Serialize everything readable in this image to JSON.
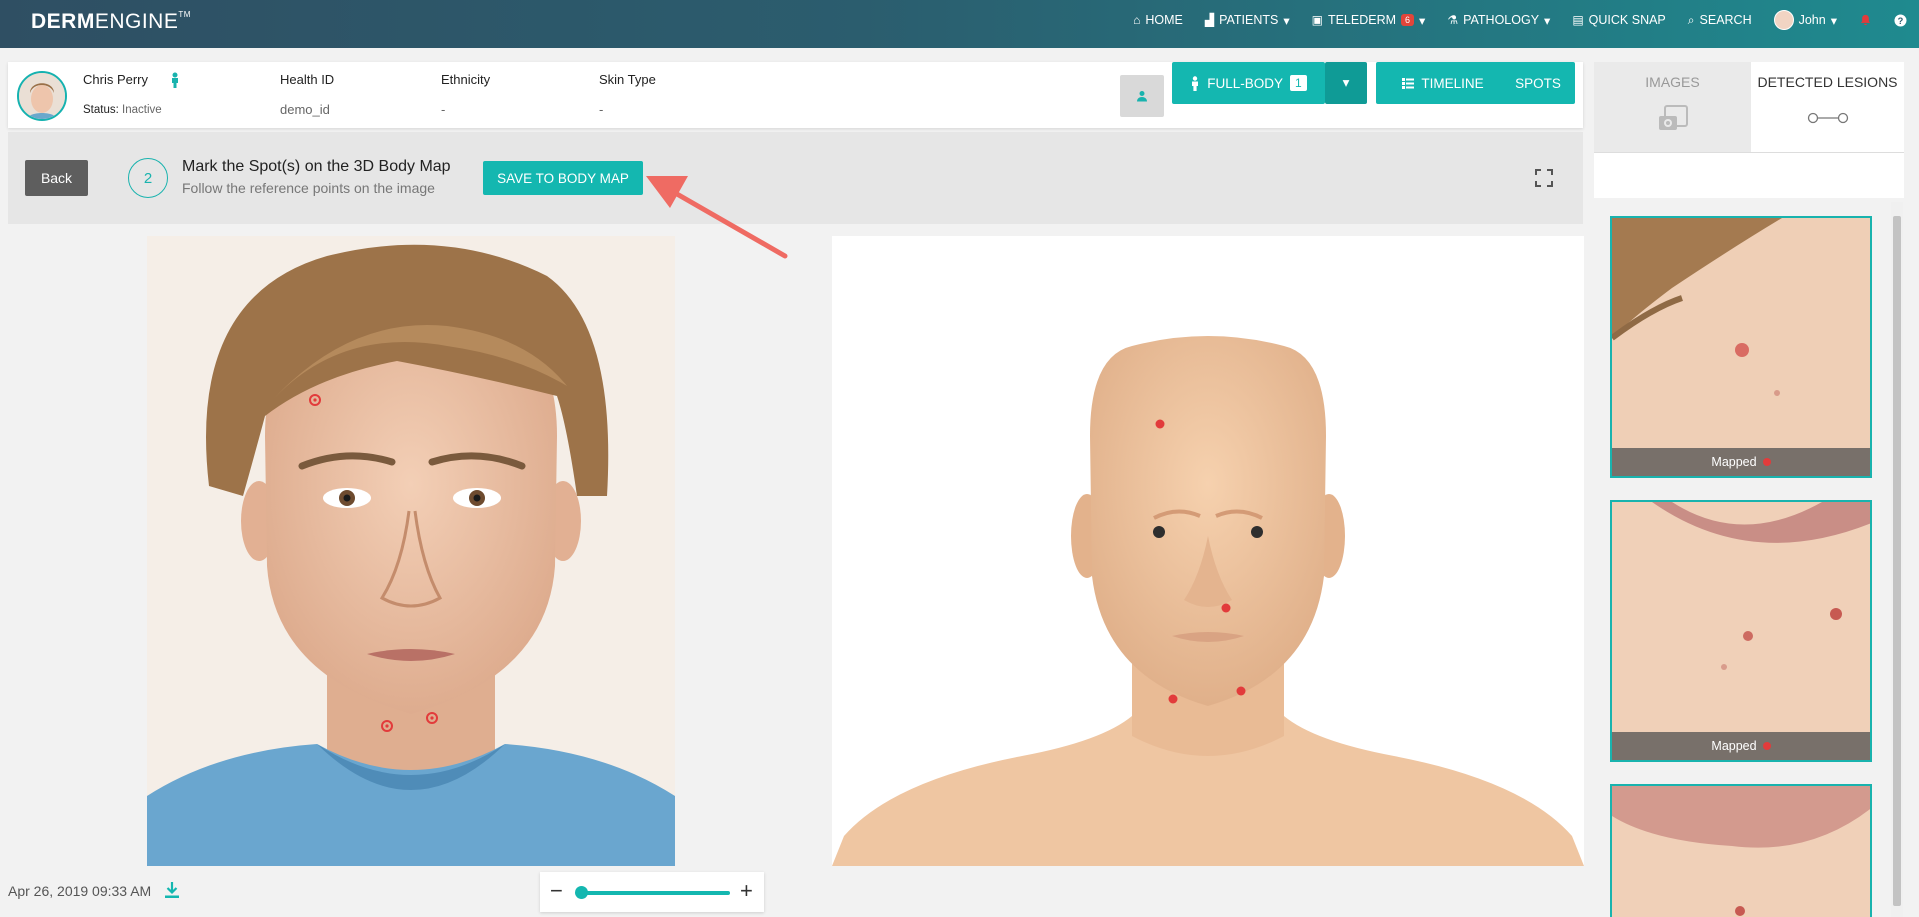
{
  "nav": {
    "logo_bold": "DERM",
    "logo_light": "ENGINE",
    "logo_tm": "TM",
    "items": [
      {
        "label": "HOME",
        "icon": "home-icon"
      },
      {
        "label": "PATIENTS",
        "icon": "patients-icon"
      },
      {
        "label": "TELEDERM",
        "icon": "telederm-icon",
        "badge": "6"
      },
      {
        "label": "PATHOLOGY",
        "icon": "microscope-icon"
      },
      {
        "label": "QUICK SNAP",
        "icon": "camera-icon"
      },
      {
        "label": "SEARCH",
        "icon": "search-icon"
      },
      {
        "label": "John",
        "icon": "avatar"
      }
    ]
  },
  "patient": {
    "name": "Chris Perry",
    "status_label": "Status:",
    "status_value": "Inactive",
    "health_id_label": "Health ID",
    "health_id_value": "demo_id",
    "ethnicity_label": "Ethnicity",
    "ethnicity_value": "-",
    "skin_type_label": "Skin Type",
    "skin_type_value": "-"
  },
  "actions": {
    "full_body_label": "FULL-BODY",
    "full_body_count": "1",
    "timeline_label": "TIMELINE",
    "spots_label": "SPOTS"
  },
  "right_panel": {
    "tab_images": "IMAGES",
    "tab_detected": "DETECTED LESIONS",
    "thumbs": [
      {
        "status": "Mapped"
      },
      {
        "status": "Mapped"
      }
    ]
  },
  "step": {
    "back_label": "Back",
    "number": "2",
    "title": "Mark the Spot(s) on the 3D Body Map",
    "subtitle": "Follow the reference points on the image",
    "save_label": "SAVE TO BODY MAP"
  },
  "footer": {
    "date": "Apr 26, 2019 09:33 AM",
    "zoom_minus": "−",
    "zoom_plus": "+"
  },
  "colors": {
    "accent": "#14b7b0",
    "marker": "#e23b3b",
    "arrow": "#ef6b63"
  }
}
